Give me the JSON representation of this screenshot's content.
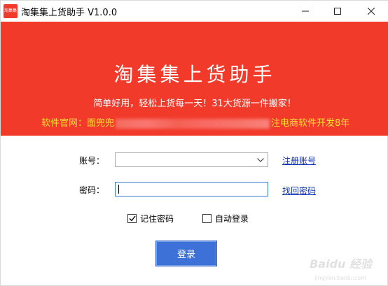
{
  "window": {
    "title": "淘集集上货助手 V1.0.0",
    "app_icon_text": "淘集集"
  },
  "banner": {
    "title": "淘集集上货助手",
    "subtitle": "简单好用，轻松上货每一天！31大货源一件搬家！",
    "site_prefix": "软件官网：面兜兜",
    "site_suffix": "注电商软件开发8年"
  },
  "form": {
    "account_label": "账号：",
    "account_value": "",
    "register_link": "注册账号",
    "password_label": "密码：",
    "password_value": "",
    "recover_link": "找回密码",
    "remember_label": "记住密码",
    "remember_checked": true,
    "autologin_label": "自动登录",
    "autologin_checked": false,
    "login_button": "登录"
  },
  "watermark": {
    "text": "Baidu 经验",
    "sub": "jingyan.baidu.com"
  },
  "colors": {
    "banner_bg": "#f23a2b",
    "site_text": "#ffe033",
    "link": "#0b2fb4",
    "button_bg": "#3d71d8"
  },
  "icons": [
    "app-icon",
    "minimize-icon",
    "maximize-icon",
    "close-icon",
    "chevron-down-icon",
    "checkmark-icon"
  ]
}
